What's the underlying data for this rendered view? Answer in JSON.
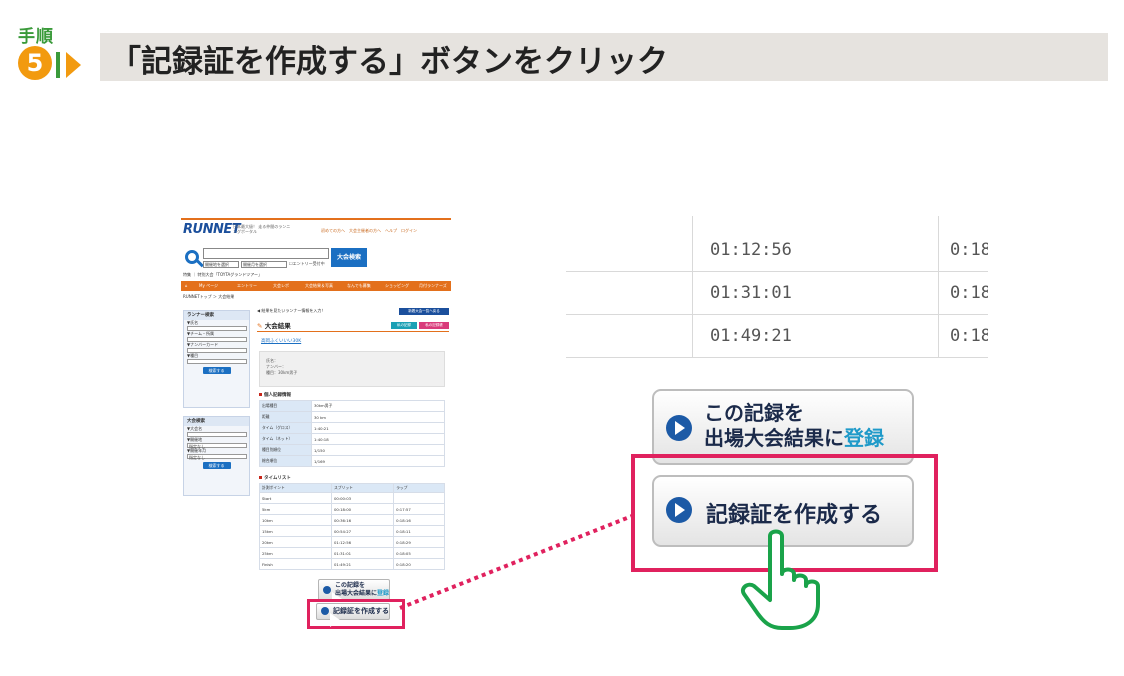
{
  "header": {
    "step_word": "手順",
    "step_number": "5",
    "title": "「記録証を作成する」ボタンをクリック"
  },
  "site": {
    "logo_main": "RUNNET",
    "logo_sub": "日本最大級！ 走る仲間のランニングポータル",
    "top_links": "初めての方へ　大会主催者の方へ　ヘルプ　ログイン",
    "search": {
      "select1": "開催地を選択",
      "select2": "開催月を選択",
      "checkbox_label": "エントリー受付中",
      "button": "大会検索"
    },
    "crumb_a": "特集 ｜ 特別大会「TOYTAグランドツアー」",
    "nav": [
      "My ページ",
      "エントリー",
      "大会レポ",
      "大会結果＆写真",
      "なんでも募集",
      "ショッピング",
      "月付ランナーズ"
    ],
    "crumb_b": "RUNNETトップ ＞ 大会結果",
    "runner_search": {
      "title": "ランナー検索",
      "fields": [
        "▼氏名",
        "▼チーム・所属",
        "▼ナンバーカード",
        "▼種目"
      ],
      "button": "検索する"
    },
    "event_search": {
      "title": "大会検索",
      "fields": [
        "▼大会名",
        "▼開催地",
        "▼開催年月"
      ],
      "select_default": "指定なし",
      "button": "検索する"
    },
    "result_note": "結果を見たいランナー情報を入力！",
    "result_list_btn": "新着大会一覧へ戻る",
    "result_title": "大会結果",
    "badge_record": "私の記録",
    "badge_photo": "私の記録帳",
    "race_link": "高岡ふくいいい30K",
    "runner_info": [
      "氏名：",
      "ナンバー：",
      "種目：30km男子"
    ],
    "personal_title": "個人記録情報",
    "personal_rows": [
      {
        "key": "出場種目",
        "value": "30km男子"
      },
      {
        "key": "距離",
        "value": "30 km"
      },
      {
        "key": "タイム（グロス）",
        "value": "1:40:21"
      },
      {
        "key": "タイム（ネット）",
        "value": "1:40:18"
      },
      {
        "key": "種目別順位",
        "value": "1/150"
      },
      {
        "key": "総合順位",
        "value": "1/169"
      }
    ],
    "timelist_title": "タイムリスト",
    "timelist_headers": [
      "計測ポイント",
      "スプリット",
      "ラップ"
    ],
    "timelist_rows": [
      [
        "Start",
        "00:00:03",
        ""
      ],
      [
        "5km",
        "00:18:00",
        "0:17:57"
      ],
      [
        "10km",
        "00:36:16",
        "0:18:16"
      ],
      [
        "15km",
        "00:54:27",
        "0:18:11"
      ],
      [
        "20km",
        "01:12:56",
        "0:18:29"
      ],
      [
        "25km",
        "01:31:01",
        "0:18:05"
      ],
      [
        "Finish",
        "01:49:21",
        "0:18:20"
      ]
    ],
    "btn_register_line1": "この記録を",
    "btn_register_line2a": "出場大会結果に",
    "btn_register_line2b": "登録",
    "btn_certificate": "記録証を作成する"
  },
  "zoom": {
    "rows": [
      {
        "split": "01:12:56",
        "lap": "0:18"
      },
      {
        "split": "01:31:01",
        "lap": "0:18"
      },
      {
        "split": "01:49:21",
        "lap": "0:18"
      }
    ],
    "btn_register_line1": "この記録を",
    "btn_register_line2a": "出場大会結果に",
    "btn_register_line2b": "登録",
    "btn_certificate": "記録証を作成する"
  },
  "colors": {
    "accent_orange": "#f29a0f",
    "step_green": "#3a9a3a",
    "highlight_magenta": "#e0215e",
    "cursor_green": "#1aa34a",
    "nav_orange": "#e3701c",
    "link_blue": "#1b6fc2"
  },
  "icons": {
    "play": "play-circle-icon",
    "cursor": "hand-pointer-icon",
    "search": "magnifier-icon"
  }
}
